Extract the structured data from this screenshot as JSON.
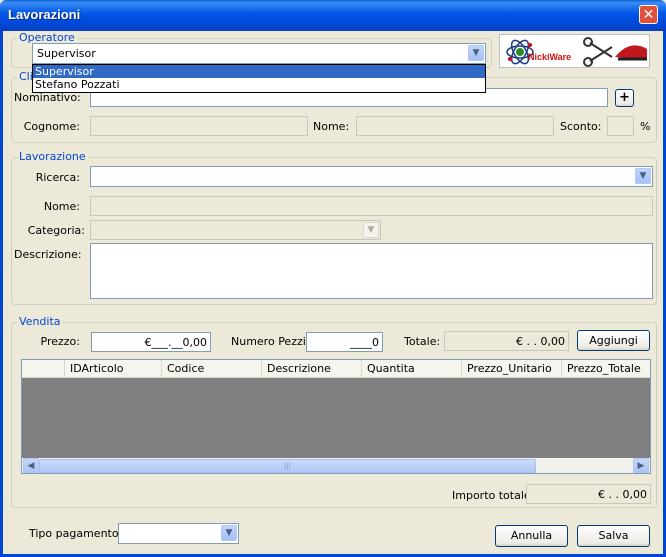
{
  "window": {
    "title": "Lavorazioni",
    "close_glyph": "✕"
  },
  "operatore": {
    "legend": "Operatore",
    "selected": "Supervisor",
    "options": [
      "Supervisor",
      "Stefano Pozzati"
    ]
  },
  "logo": {
    "text": "NickiWare",
    "icon": "hair-salon-tools-logo"
  },
  "cliente": {
    "legend": "Cli",
    "nominativo_label": "Nominativo:",
    "nominativo_value": "",
    "add_glyph": "+",
    "cognome_label": "Cognome:",
    "nome_label": "Nome:",
    "sconto_label": "Sconto:",
    "percent": "%"
  },
  "lavorazione": {
    "legend": "Lavorazione",
    "ricerca_label": "Ricerca:",
    "nome_label": "Nome:",
    "categoria_label": "Categoria:",
    "descrizione_label": "Descrizione:"
  },
  "vendita": {
    "legend": "Vendita",
    "prezzo_label": "Prezzo:",
    "prezzo_value": "€___.__0,00",
    "numero_pezzi_label": "Numero Pezzi:",
    "numero_pezzi_value": "____0",
    "totale_label": "Totale:",
    "totale_value": "€ .  . 0,00",
    "aggiungi_label": "Aggiungi",
    "columns": [
      "IDArticolo",
      "Codice",
      "Descrizione",
      "Quantita",
      "Prezzo_Unitario",
      "Prezzo_Totale"
    ],
    "rows": [],
    "importo_label": "Importo totale:",
    "importo_value": "€ .  . 0,00"
  },
  "footer": {
    "tipo_pagamento_label": "Tipo pagamento:",
    "tipo_pagamento_value": "",
    "annulla_label": "Annulla",
    "salva_label": "Salva"
  },
  "colors": {
    "titlebar": "#0055e5",
    "legend": "#0046d5",
    "selection": "#316ac5",
    "grid_body": "#808080"
  }
}
